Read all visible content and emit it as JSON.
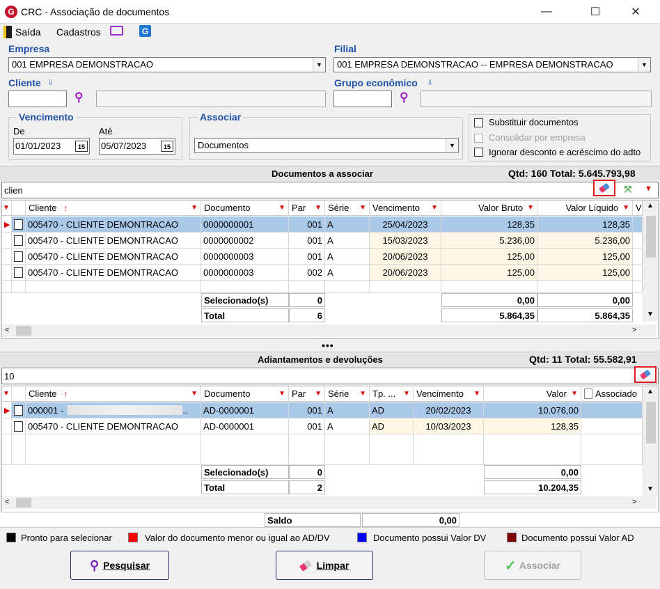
{
  "window": {
    "title": "CRC - Associação de documentos"
  },
  "menu": {
    "saida": "Saída",
    "cadastros": "Cadastros"
  },
  "filters": {
    "empresa_label": "Empresa",
    "empresa_value": "001 EMPRESA DEMONSTRACAO",
    "filial_label": "Filial",
    "filial_value": "001 EMPRESA DEMONSTRACAO -- EMPRESA DEMONSTRACAO",
    "cliente_label": "Cliente",
    "grupo_label": "Grupo econômico",
    "vencimento_label": "Vencimento",
    "de_label": "De",
    "de_value": "01/01/2023",
    "ate_label": "Até",
    "ate_value": "05/07/2023",
    "associar_label": "Associar",
    "associar_value": "Documentos",
    "substituir_label": "Substituir documentos",
    "consolidar_label": "Consolidar por empresa",
    "ignorar_label": "Ignorar desconto e acréscimo do adto",
    "calendar_icon_text": "15"
  },
  "docs": {
    "title": "Documentos a associar",
    "summary": "Qtd: 160 Total: 5.645.793,98",
    "search_value": "clien",
    "headers": [
      "Cliente",
      "Documento",
      "Par",
      "Série",
      "Vencimento",
      "Valor Bruto",
      "Valor Líquido",
      "V"
    ],
    "rows": [
      [
        "005470 - CLIENTE DEMONTRACAO",
        "0000000001",
        "001",
        "A",
        "25/04/2023",
        "128,35",
        "128,35"
      ],
      [
        "005470 - CLIENTE DEMONTRACAO",
        "0000000002",
        "001",
        "A",
        "15/03/2023",
        "5.236,00",
        "5.236,00"
      ],
      [
        "005470 - CLIENTE DEMONTRACAO",
        "0000000003",
        "001",
        "A",
        "20/06/2023",
        "125,00",
        "125,00"
      ],
      [
        "005470 - CLIENTE DEMONTRACAO",
        "0000000003",
        "002",
        "A",
        "20/06/2023",
        "125,00",
        "125,00"
      ]
    ],
    "selecionados_label": "Selecionado(s)",
    "selecionados_count": "0",
    "selecionados_bruto": "0,00",
    "selecionados_liquido": "0,00",
    "total_label": "Total",
    "total_count": "6",
    "total_bruto": "5.864,35",
    "total_liquido": "5.864,35"
  },
  "splitter": "•••",
  "adts": {
    "title": "Adiantamentos e devoluções",
    "summary": "Qtd: 11 Total: 55.582,91",
    "search_value": "10",
    "headers": [
      "Cliente",
      "Documento",
      "Par",
      "Série",
      "Tp. ...",
      "Vencimento",
      "Valor",
      "Associado"
    ],
    "rows": [
      [
        "000001 -",
        "AD-0000001",
        "001",
        "A",
        "AD",
        "20/02/2023",
        "10.076,00",
        ""
      ],
      [
        "005470 - CLIENTE DEMONTRACAO",
        "AD-0000001",
        "001",
        "A",
        "AD",
        "10/03/2023",
        "128,35",
        ""
      ]
    ],
    "selecionados_label": "Selecionado(s)",
    "selecionados_count": "0",
    "selecionados_valor": "0,00",
    "total_label": "Total",
    "total_count": "2",
    "total_valor": "10.204,35"
  },
  "saldo": {
    "label": "Saldo",
    "value": "0,00"
  },
  "legend": [
    {
      "label": "Pronto para selecionar",
      "color": "#000000"
    },
    {
      "label": "Valor do documento menor ou igual ao AD/DV",
      "color": "#ff0000"
    },
    {
      "label": "Documento possui Valor DV",
      "color": "#0000ff"
    },
    {
      "label": "Documento possui Valor AD",
      "color": "#800000"
    }
  ],
  "buttons": {
    "pesquisar": "Pesquisar",
    "limpar": "Limpar",
    "associar": "Associar"
  }
}
